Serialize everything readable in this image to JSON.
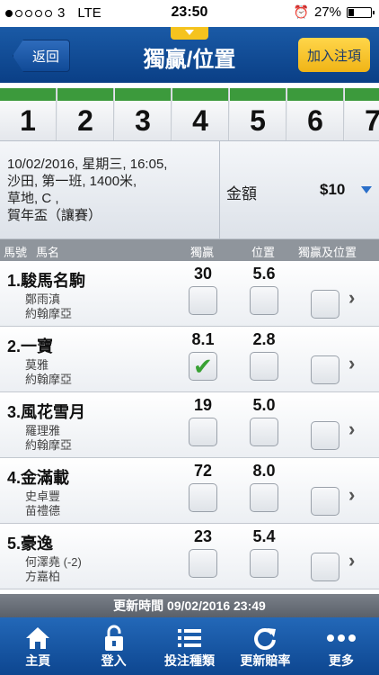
{
  "status_bar": {
    "carrier": "3",
    "network": "LTE",
    "time": "23:50",
    "battery": "27%",
    "battery_level": 0.27,
    "signal_bars": 1
  },
  "header": {
    "back_label": "返回",
    "title": "獨贏/位置",
    "add_label": "加入注項"
  },
  "race_tabs": [
    {
      "label": "1"
    },
    {
      "label": "2"
    },
    {
      "label": "3"
    },
    {
      "label": "4"
    },
    {
      "label": "5"
    },
    {
      "label": "6"
    },
    {
      "label": "7"
    }
  ],
  "race_info": {
    "line1": "10/02/2016, 星期三, 16:05,",
    "line2": "沙田, 第一班, 1400米,",
    "line3": "草地, C ,",
    "line4": "賀年盃（讓賽）"
  },
  "amount": {
    "label": "金額",
    "value": "$10"
  },
  "columns": {
    "no": "馬號",
    "name": "馬名",
    "win": "獨贏",
    "place": "位置",
    "both": "獨贏及位置"
  },
  "horses": [
    {
      "name": "1.駿馬名駒",
      "jockey": "鄭雨滇",
      "trainer": "約翰摩亞",
      "win": "30",
      "place": "5.6",
      "win_checked": false
    },
    {
      "name": "2.一寶",
      "jockey": "莫雅",
      "trainer": "約翰摩亞",
      "win": "8.1",
      "place": "2.8",
      "win_checked": true
    },
    {
      "name": "3.風花雪月",
      "jockey": "羅理雅",
      "trainer": "約翰摩亞",
      "win": "19",
      "place": "5.0",
      "win_checked": false
    },
    {
      "name": "4.金滿載",
      "jockey": "史卓豐",
      "trainer": "苗禮德",
      "win": "72",
      "place": "8.0",
      "win_checked": false
    },
    {
      "name": "5.豪逸",
      "jockey": "何澤堯 (-2)",
      "trainer": "方嘉柏",
      "win": "23",
      "place": "5.4",
      "win_checked": false
    }
  ],
  "update_text": "更新時間 09/02/2016 23:49",
  "tabbar": [
    {
      "label": "主頁",
      "icon": "home-icon"
    },
    {
      "label": "登入",
      "icon": "lock-icon"
    },
    {
      "label": "投注種類",
      "icon": "list-icon"
    },
    {
      "label": "更新賠率",
      "icon": "refresh-icon"
    },
    {
      "label": "更多",
      "icon": "more-icon"
    }
  ],
  "colors": {
    "header_blue": "#0a3f86",
    "accent_yellow": "#f5c31e",
    "race_green": "#3c9a3c",
    "check_green": "#38a133"
  }
}
